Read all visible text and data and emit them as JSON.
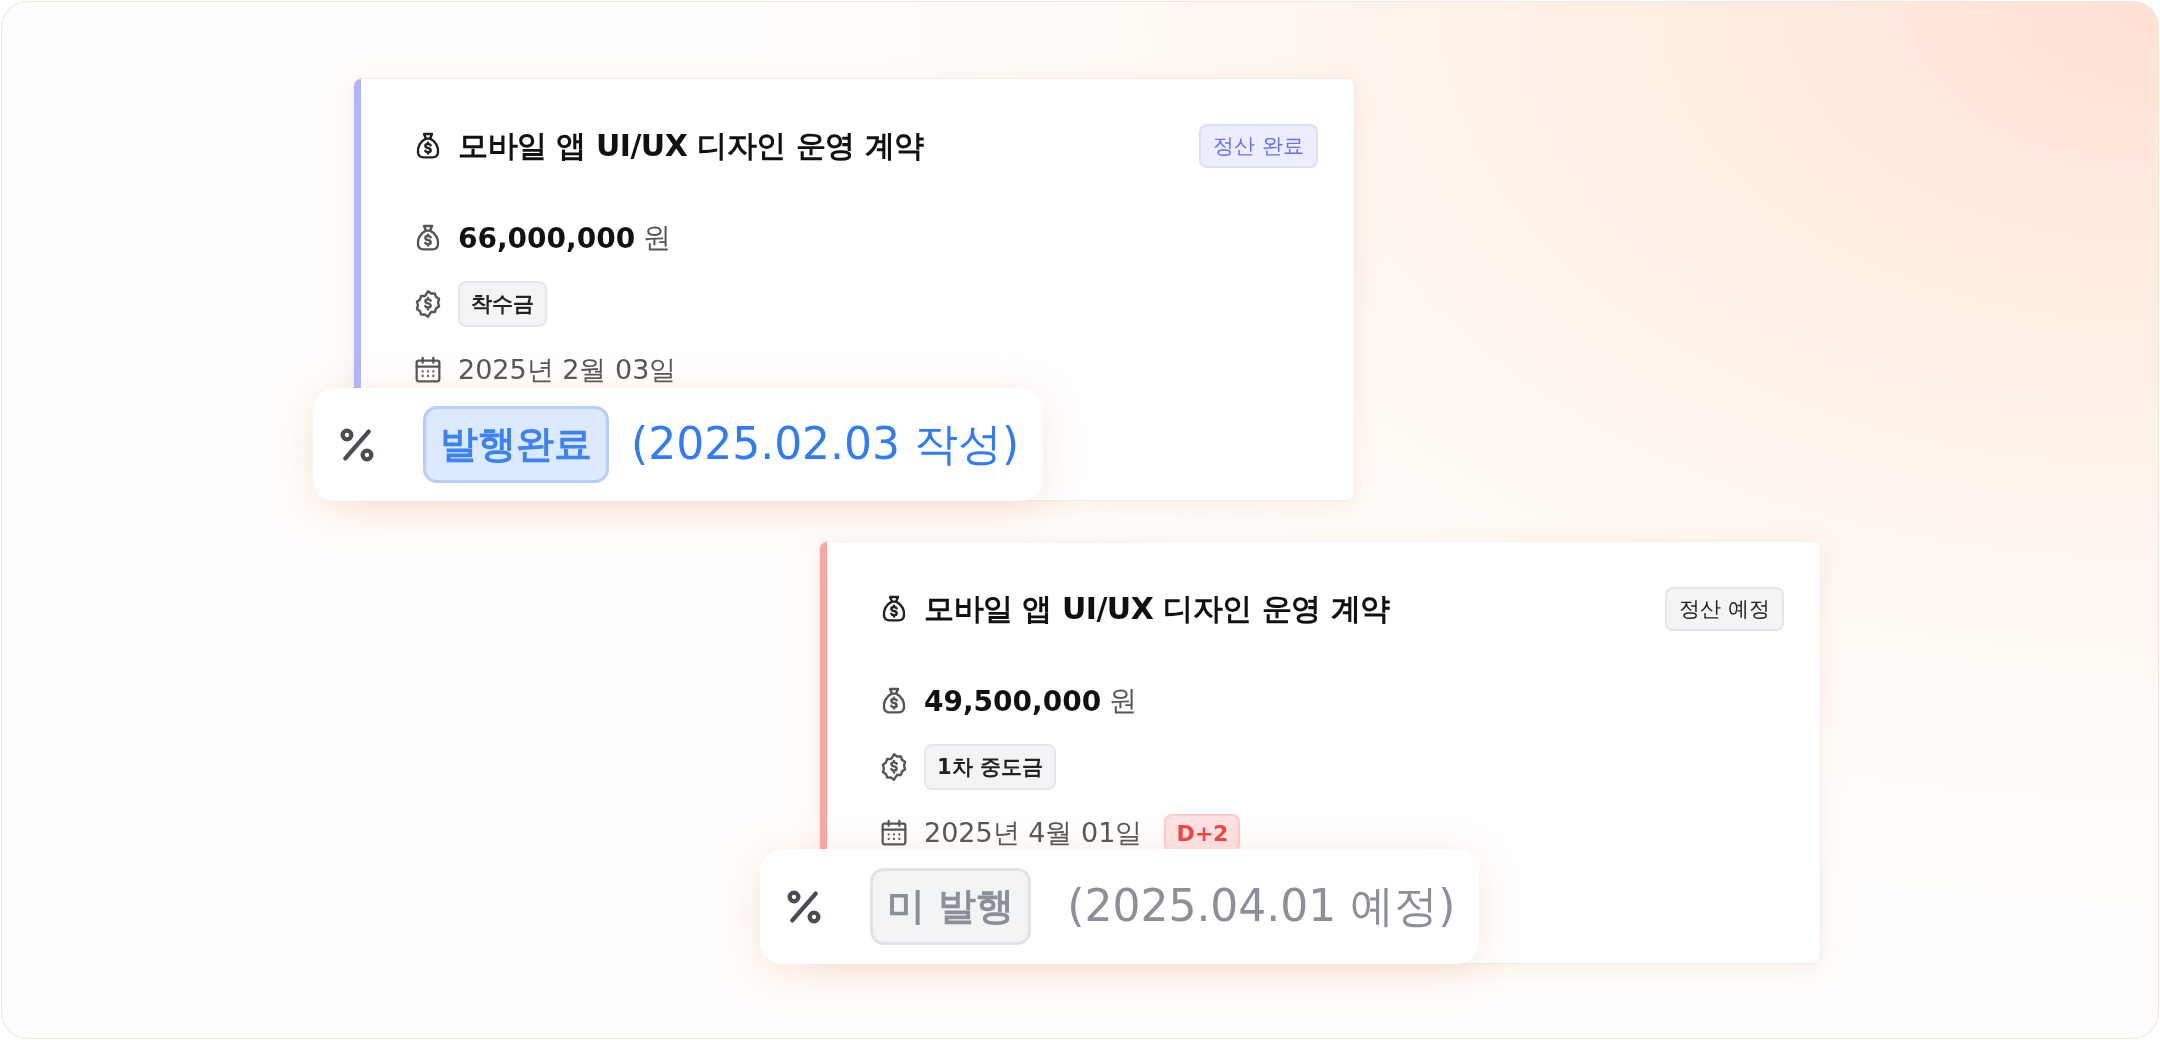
{
  "cards": [
    {
      "color": "#b1b6fc",
      "title": "모바일 앱 UI/UX 디자인 운영 계약",
      "status": {
        "label": "정산 완료",
        "kind": "done"
      },
      "amount": "66,000,000",
      "unit": "원",
      "payment_type": "착수금",
      "date": "2025년 2월 03일",
      "invoice": {
        "label": "발행완료",
        "kind": "issued",
        "note": "(2025.02.03 작성)"
      }
    },
    {
      "color": "#fca5a5",
      "title": "모바일 앱 UI/UX 디자인 운영 계약",
      "status": {
        "label": "정산 예정",
        "kind": "scheduled"
      },
      "amount": "49,500,000",
      "unit": "원",
      "payment_type": "1차 중도금",
      "date": "2025년 4월 01일",
      "d_day": "D+2",
      "invoice": {
        "label": "미 발행",
        "kind": "pending",
        "note": "(2025.04.01 예정)"
      }
    }
  ]
}
